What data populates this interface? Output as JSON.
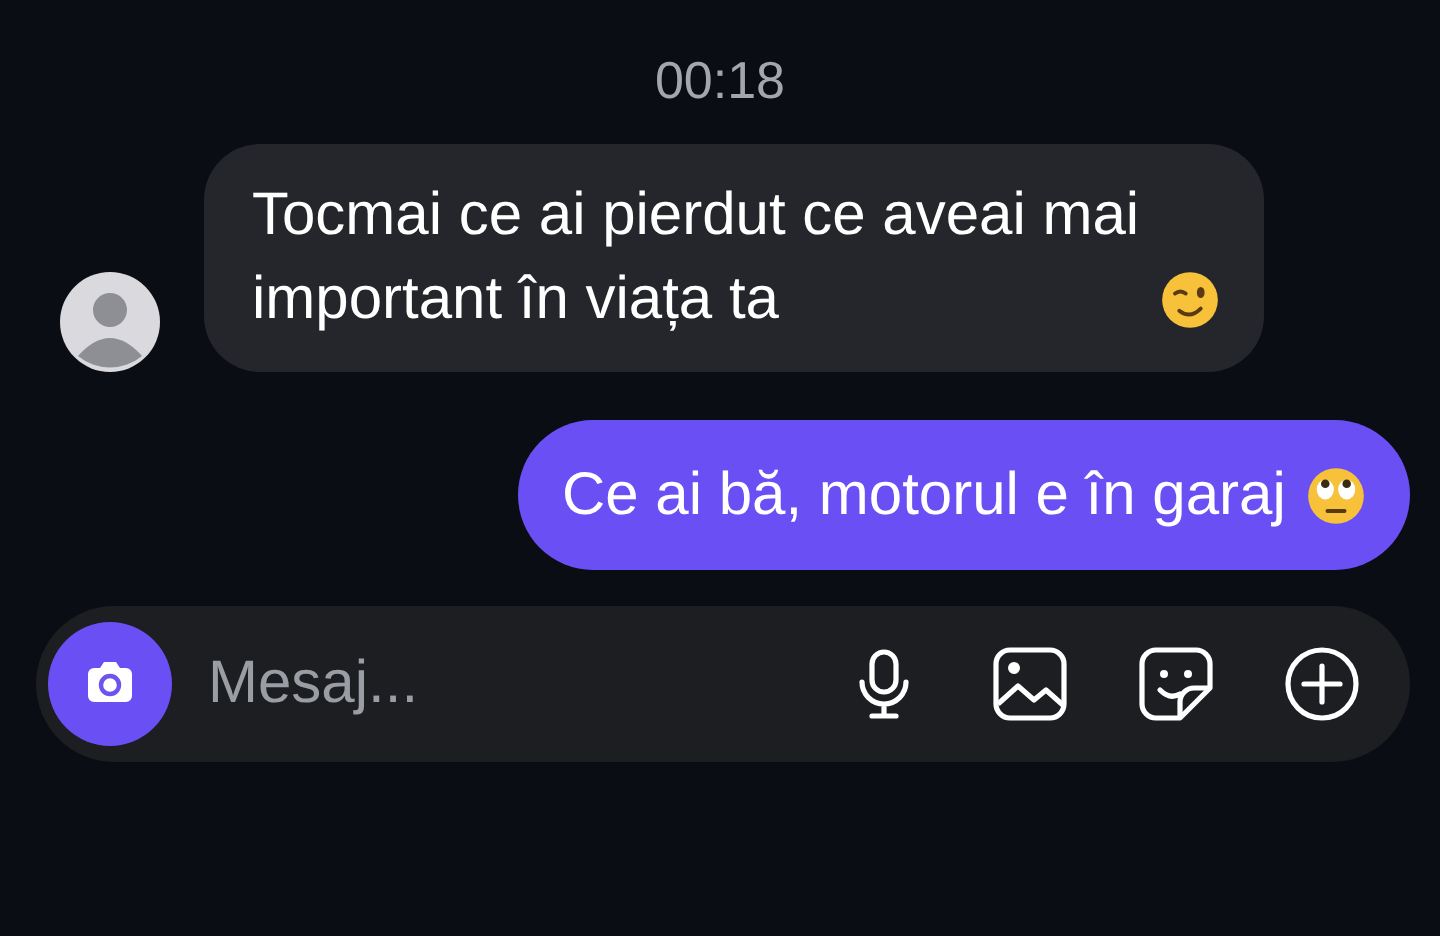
{
  "timestamp": "00:18",
  "messages": [
    {
      "kind": "received",
      "text": "Tocmai ce ai pierdut ce aveai mai important în viața ta",
      "emoji": {
        "kind": "wink"
      }
    },
    {
      "kind": "sent",
      "text": "Ce ai bă, motorul e în garaj",
      "emoji": {
        "kind": "eye-roll"
      }
    }
  ],
  "composer": {
    "placeholder": "Mesaj..."
  }
}
